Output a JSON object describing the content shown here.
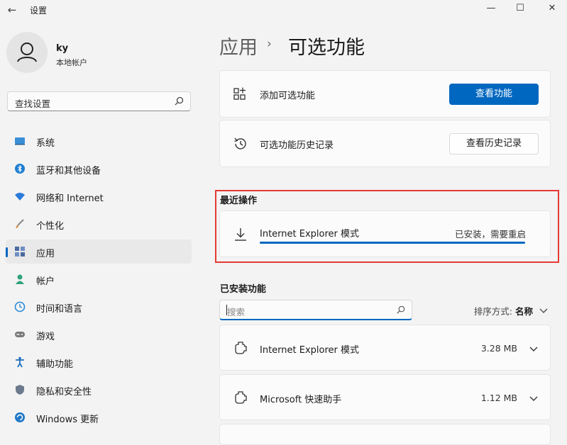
{
  "window": {
    "title": "设置",
    "back_icon": "back-arrow-icon",
    "minimize": "—",
    "maximize": "☐",
    "close": "✕"
  },
  "user": {
    "name": "ky",
    "account_type": "本地帐户",
    "avatar_icon": "person-icon"
  },
  "sidebar": {
    "search_placeholder": "查找设置",
    "items": [
      {
        "label": "系统",
        "icon": "monitor-icon",
        "color": "#3a8fd6"
      },
      {
        "label": "蓝牙和其他设备",
        "icon": "bluetooth-icon",
        "color": "#1f7fd1"
      },
      {
        "label": "网络和 Internet",
        "icon": "wifi-icon",
        "color": "#2a7ad9"
      },
      {
        "label": "个性化",
        "icon": "brush-icon",
        "color": "#d98a3a"
      },
      {
        "label": "应用",
        "icon": "apps-icon",
        "color": "#4a6aa0",
        "selected": true
      },
      {
        "label": "帐户",
        "icon": "account-icon",
        "color": "#2fa37a"
      },
      {
        "label": "时间和语言",
        "icon": "clock-globe-icon",
        "color": "#2a8ad6"
      },
      {
        "label": "游戏",
        "icon": "gamepad-icon",
        "color": "#7a7a7a"
      },
      {
        "label": "辅助功能",
        "icon": "accessibility-icon",
        "color": "#1d6fc0"
      },
      {
        "label": "隐私和安全性",
        "icon": "shield-icon",
        "color": "#6b7a8c"
      },
      {
        "label": "Windows 更新",
        "icon": "update-icon",
        "color": "#1f78c8"
      }
    ]
  },
  "breadcrumb": {
    "parent": "应用",
    "separator": "›",
    "current": "可选功能"
  },
  "add_feature": {
    "label": "添加可选功能",
    "button": "查看功能"
  },
  "history": {
    "label": "可选功能历史记录",
    "button": "查看历史记录"
  },
  "recent": {
    "heading": "最近操作",
    "item": {
      "name": "Internet Explorer 模式",
      "status": "已安装，需要重启",
      "progress": 1.0
    }
  },
  "installed": {
    "heading": "已安装功能",
    "search_placeholder": "搜索",
    "sort_label": "排序方式:",
    "sort_value": "名称",
    "items": [
      {
        "name": "Internet Explorer 模式",
        "size": "3.28 MB"
      },
      {
        "name": "Microsoft 快速助手",
        "size": "1.12 MB"
      }
    ]
  },
  "colors": {
    "accent": "#0067c0",
    "highlight_border": "#e53935"
  }
}
